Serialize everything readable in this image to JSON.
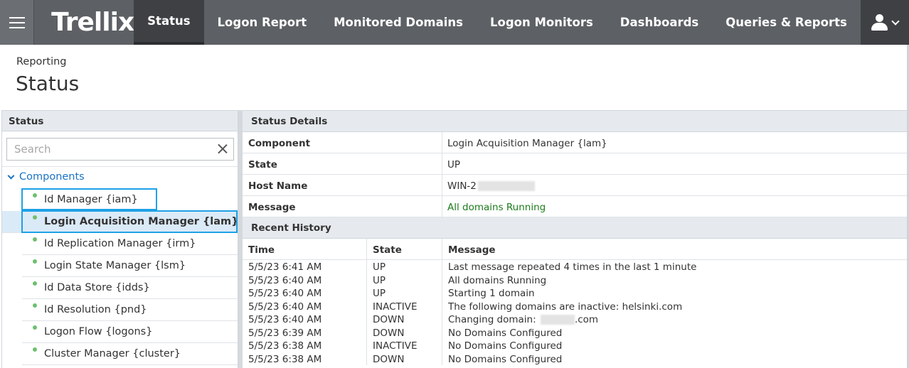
{
  "app": {
    "logo": "Trellix"
  },
  "nav": {
    "items": [
      {
        "label": "Status",
        "active": true
      },
      {
        "label": "Logon Report"
      },
      {
        "label": "Monitored Domains"
      },
      {
        "label": "Logon Monitors"
      },
      {
        "label": "Dashboards"
      },
      {
        "label": "Queries & Reports"
      }
    ],
    "menu_icon": "hamburger-icon",
    "user_icon": "user-icon"
  },
  "header": {
    "breadcrumb": "Reporting",
    "title": "Status"
  },
  "left": {
    "heading": "Status",
    "search_placeholder": "Search",
    "tree_root": "Components",
    "items": [
      {
        "label": "Id Manager {iam}",
        "status": "up"
      },
      {
        "label": "Login Acquisition Manager {lam}",
        "status": "up",
        "selected": true
      },
      {
        "label": "Id Replication Manager {irm}",
        "status": "up"
      },
      {
        "label": "Login State Manager {lsm}",
        "status": "up"
      },
      {
        "label": "Id Data Store {idds}",
        "status": "up"
      },
      {
        "label": "Id Resolution {pnd}",
        "status": "up"
      },
      {
        "label": "Logon Flow {logons}",
        "status": "up"
      },
      {
        "label": "Cluster Manager {cluster}",
        "status": "up"
      }
    ]
  },
  "details": {
    "heading": "Status Details",
    "rows": [
      {
        "key": "Component",
        "value": "Login Acquisition Manager {lam}"
      },
      {
        "key": "State",
        "value": "UP"
      },
      {
        "key": "Host Name",
        "value": "WIN-2"
      },
      {
        "key": "Message",
        "value": "All domains Running"
      }
    ]
  },
  "history": {
    "heading": "Recent History",
    "columns": [
      "Time",
      "State",
      "Message"
    ],
    "rows": [
      {
        "time": "5/5/23 6:41 AM",
        "state": "UP",
        "message": "Last message repeated 4 times in the last 1 minute"
      },
      {
        "time": "5/5/23 6:40 AM",
        "state": "UP",
        "message": "All domains Running"
      },
      {
        "time": "5/5/23 6:40 AM",
        "state": "UP",
        "message": "Starting 1 domain"
      },
      {
        "time": "5/5/23 6:40 AM",
        "state": "INACTIVE",
        "message": "The following domains are inactive: helsinki.com"
      },
      {
        "time": "5/5/23 6:40 AM",
        "state": "DOWN",
        "message": "Changing domain:",
        "message_suffix": ".com"
      },
      {
        "time": "5/5/23 6:39 AM",
        "state": "DOWN",
        "message": "No Domains Configured"
      },
      {
        "time": "5/5/23 6:38 AM",
        "state": "INACTIVE",
        "message": "No Domains Configured"
      },
      {
        "time": "5/5/23 6:38 AM",
        "state": "DOWN",
        "message": "No Domains Configured"
      }
    ]
  },
  "colors": {
    "topbar": "#5d6064",
    "active_tab": "#3e4044",
    "link_blue": "#1a73c4",
    "highlight_border": "#1ea1e6",
    "status_green": "#6fbf6f",
    "message_green": "#1c7d1c"
  }
}
